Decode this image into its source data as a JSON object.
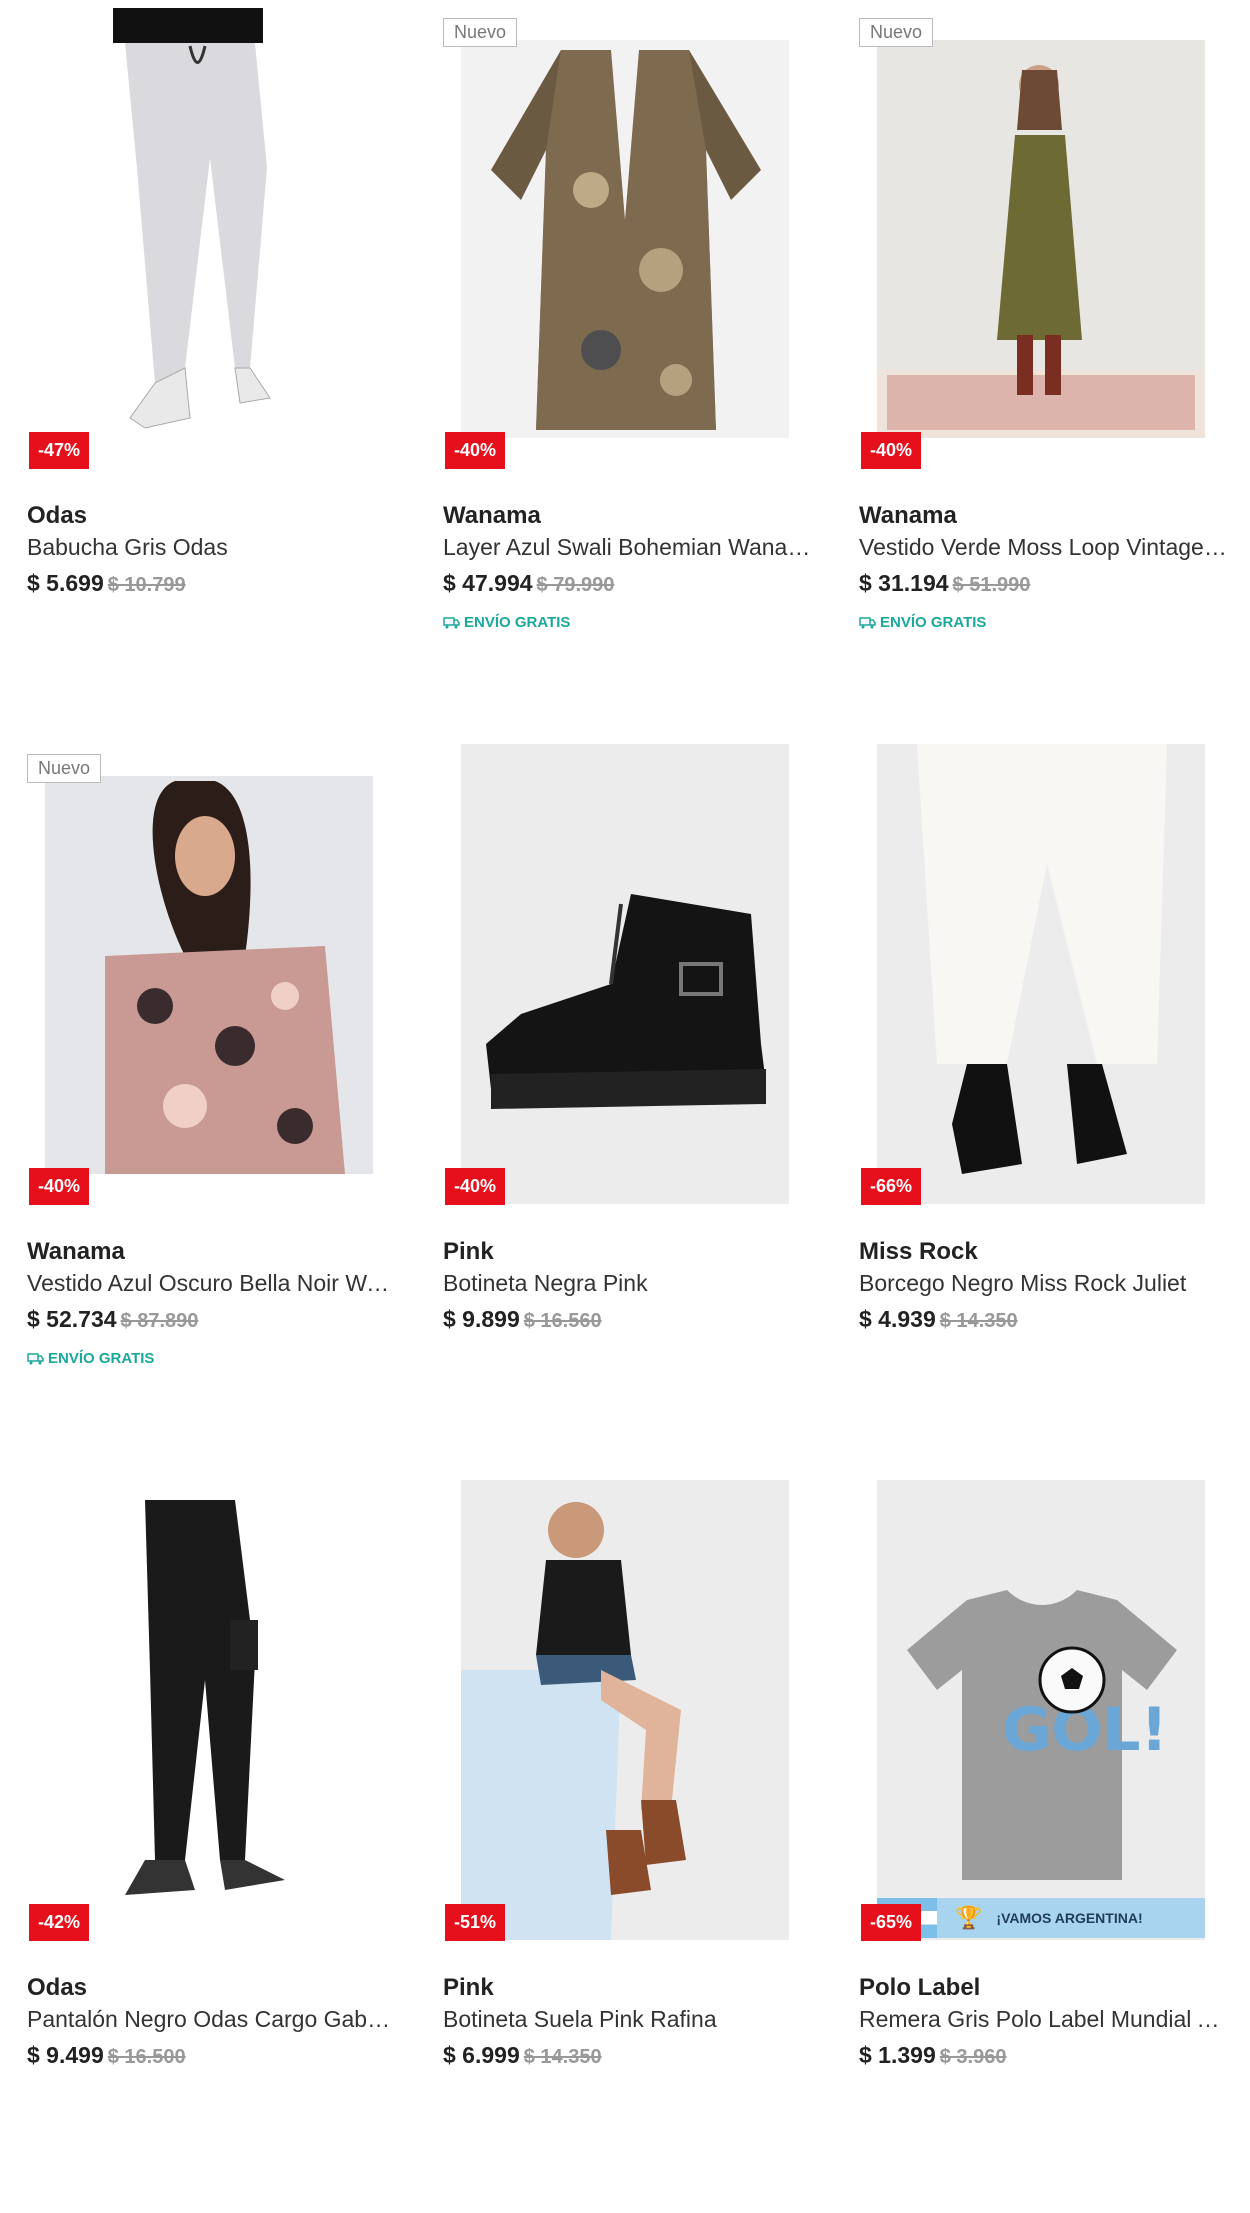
{
  "products": [
    {
      "brand": "Odas",
      "name": "Babucha Gris Odas",
      "price": "$ 5.699",
      "old_price": "$ 10.799",
      "discount": "-47%",
      "is_new": false,
      "free_shipping": false,
      "image": "grey-joggers-image"
    },
    {
      "brand": "Wanama",
      "name": "Layer Azul Swali Bohemian Wanama",
      "price": "$ 47.994",
      "old_price": "$ 79.990",
      "discount": "-40%",
      "is_new": true,
      "free_shipping": true,
      "image": "paisley-kimono-image"
    },
    {
      "brand": "Wanama",
      "name": "Vestido Verde Moss Loop Vintage Wanama",
      "price": "$ 31.194",
      "old_price": "$ 51.990",
      "discount": "-40%",
      "is_new": true,
      "free_shipping": true,
      "image": "green-dress-image"
    },
    {
      "brand": "Wanama",
      "name": "Vestido Azul Oscuro Bella Noir Wanama",
      "price": "$ 52.734",
      "old_price": "$ 87.890",
      "discount": "-40%",
      "is_new": true,
      "free_shipping": true,
      "image": "floral-blouse-image"
    },
    {
      "brand": "Pink",
      "name": "Botineta Negra Pink",
      "price": "$ 9.899",
      "old_price": "$ 16.560",
      "discount": "-40%",
      "is_new": false,
      "free_shipping": false,
      "image": "black-boot-image"
    },
    {
      "brand": "Miss Rock",
      "name": "Borcego Negro Miss Rock Juliet",
      "price": "$ 4.939",
      "old_price": "$ 14.350",
      "discount": "-66%",
      "is_new": false,
      "free_shipping": false,
      "image": "white-pants-boots-image"
    },
    {
      "brand": "Odas",
      "name": "Pantalón Negro Odas Cargo Gabardina",
      "price": "$ 9.499",
      "old_price": "$ 16.500",
      "discount": "-42%",
      "is_new": false,
      "free_shipping": false,
      "image": "black-cargo-pants-image"
    },
    {
      "brand": "Pink",
      "name": "Botineta Suela Pink Rafina",
      "price": "$ 6.999",
      "old_price": "$ 14.350",
      "discount": "-51%",
      "is_new": false,
      "free_shipping": false,
      "image": "brown-boots-image"
    },
    {
      "brand": "Polo Label",
      "name": "Remera Gris Polo Label Mundial Argentina",
      "price": "$ 1.399",
      "old_price": "$ 3.960",
      "discount": "-65%",
      "is_new": false,
      "free_shipping": false,
      "image": "grey-tshirt-image",
      "banner_text": "¡VAMOS ARGENTINA!"
    }
  ],
  "labels": {
    "new_badge": "Nuevo",
    "free_shipping": "ENVÍO GRATIS"
  },
  "colors": {
    "discount_bg": "#e5101b",
    "free_shipping": "#1aa99a",
    "old_price": "#999999"
  }
}
